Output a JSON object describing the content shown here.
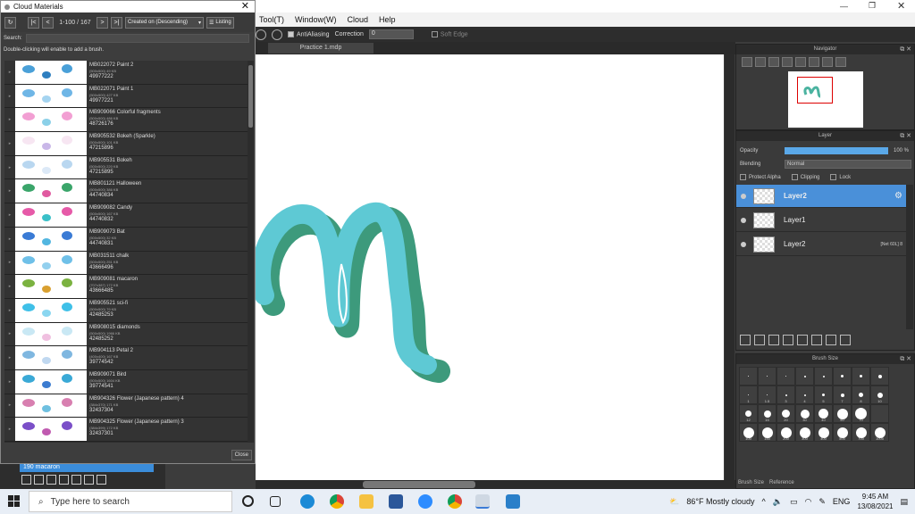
{
  "dialog": {
    "title": "Cloud Materials",
    "page_info": "1-100 / 167",
    "sort": "Created on (Descending)",
    "view_label": "Listing",
    "search_label": "Search:",
    "search_value": "",
    "hint": "Double-clicking will enable to add a brush.",
    "close_label": "Close",
    "items": [
      {
        "name": "MB022072 Paint 2",
        "size": "(500x500) 49 KB",
        "id": "49977222"
      },
      {
        "name": "MB022071 Paint 1",
        "size": "(500x500) 427 KB",
        "id": "49977221"
      },
      {
        "name": "MB909066 Colorful fragments",
        "size": "(500x500) 486 KB",
        "id": "48726176"
      },
      {
        "name": "MB905532 Bokeh (Sparkle)",
        "size": "(500x500) 101 KB",
        "id": "47215896"
      },
      {
        "name": "MB905531 Bokeh",
        "size": "(500x500) 220 KB",
        "id": "47215895"
      },
      {
        "name": "MB801121 Halloween",
        "size": "(500x500) 386 KB",
        "id": "44740834"
      },
      {
        "name": "MB909082 Candy",
        "size": "(500x500) 167 KB",
        "id": "44740832"
      },
      {
        "name": "MB909073 Bat",
        "size": "(500x500) 32 KB",
        "id": "44740831"
      },
      {
        "name": "MB031511 chalk",
        "size": "(500x500) 251 KB",
        "id": "43666496"
      },
      {
        "name": "MB909081 macaron",
        "size": "(707x387) 172 KB",
        "id": "43666485"
      },
      {
        "name": "MB905521 sci-fi",
        "size": "(500x500) 79 KB",
        "id": "42485253"
      },
      {
        "name": "MB908015 diamonds",
        "size": "(500x500) 1966 KB",
        "id": "42485252"
      },
      {
        "name": "MB904113 Petal 2",
        "size": "(400x400) 167 KB",
        "id": "39774542"
      },
      {
        "name": "MB909071 Bird",
        "size": "(500x500) 1604 KB",
        "id": "39774541"
      },
      {
        "name": "MB904326 Flower (Japanese pattern) 4",
        "size": "(384x370) 171 KB",
        "id": "32437304"
      },
      {
        "name": "MB904325 Flower (Japanese pattern) 3",
        "size": "(384x399) 172 KB",
        "id": "32437301"
      }
    ]
  },
  "menu": [
    "Tool(T)",
    "Window(W)",
    "Cloud",
    "Help"
  ],
  "toolbar": {
    "antialias": "AntiAliasing",
    "correction": "Correction",
    "correction_value": "0",
    "soft_edge": "Soft Edge"
  },
  "doc_tab": "Practice 1.mdp",
  "navigator": {
    "title": "Navigator"
  },
  "layer_panel": {
    "title": "Layer",
    "opacity_label": "Opacity",
    "opacity_value": "100 %",
    "blending_label": "Blending",
    "blending_value": "Normal",
    "protect_alpha": "Protect Alpha",
    "clipping": "Clipping",
    "lock": "Lock",
    "layers": [
      {
        "name": "Layer2",
        "selected": true
      },
      {
        "name": "Layer1",
        "selected": false
      },
      {
        "name": "Layer2",
        "selected": false,
        "badge": "[Net 60L] 8"
      }
    ]
  },
  "brush_size": {
    "title": "Brush Size",
    "sizes": [
      "",
      "",
      "",
      "",
      "",
      "",
      "",
      "",
      "1",
      "1.5",
      "3",
      "4",
      "5",
      "7",
      "8",
      "10",
      "12",
      "15",
      "20",
      "30",
      "40",
      "50",
      "70",
      "",
      "100",
      "150",
      "200",
      "300",
      "400",
      "500",
      "700",
      "1000"
    ],
    "tabs": [
      "Brush Size",
      "Reference"
    ]
  },
  "lower_left": {
    "folder_label": "190 macaron"
  },
  "taskbar": {
    "search_placeholder": "Type here to search",
    "weather": "86°F Mostly cloudy",
    "lang": "ENG",
    "time": "9:45 AM",
    "date": "13/08/2021"
  },
  "colors": {
    "accent": "#3b8ddb",
    "stroke_dark": "#3d9a7c",
    "stroke_light": "#5ec9d4"
  }
}
